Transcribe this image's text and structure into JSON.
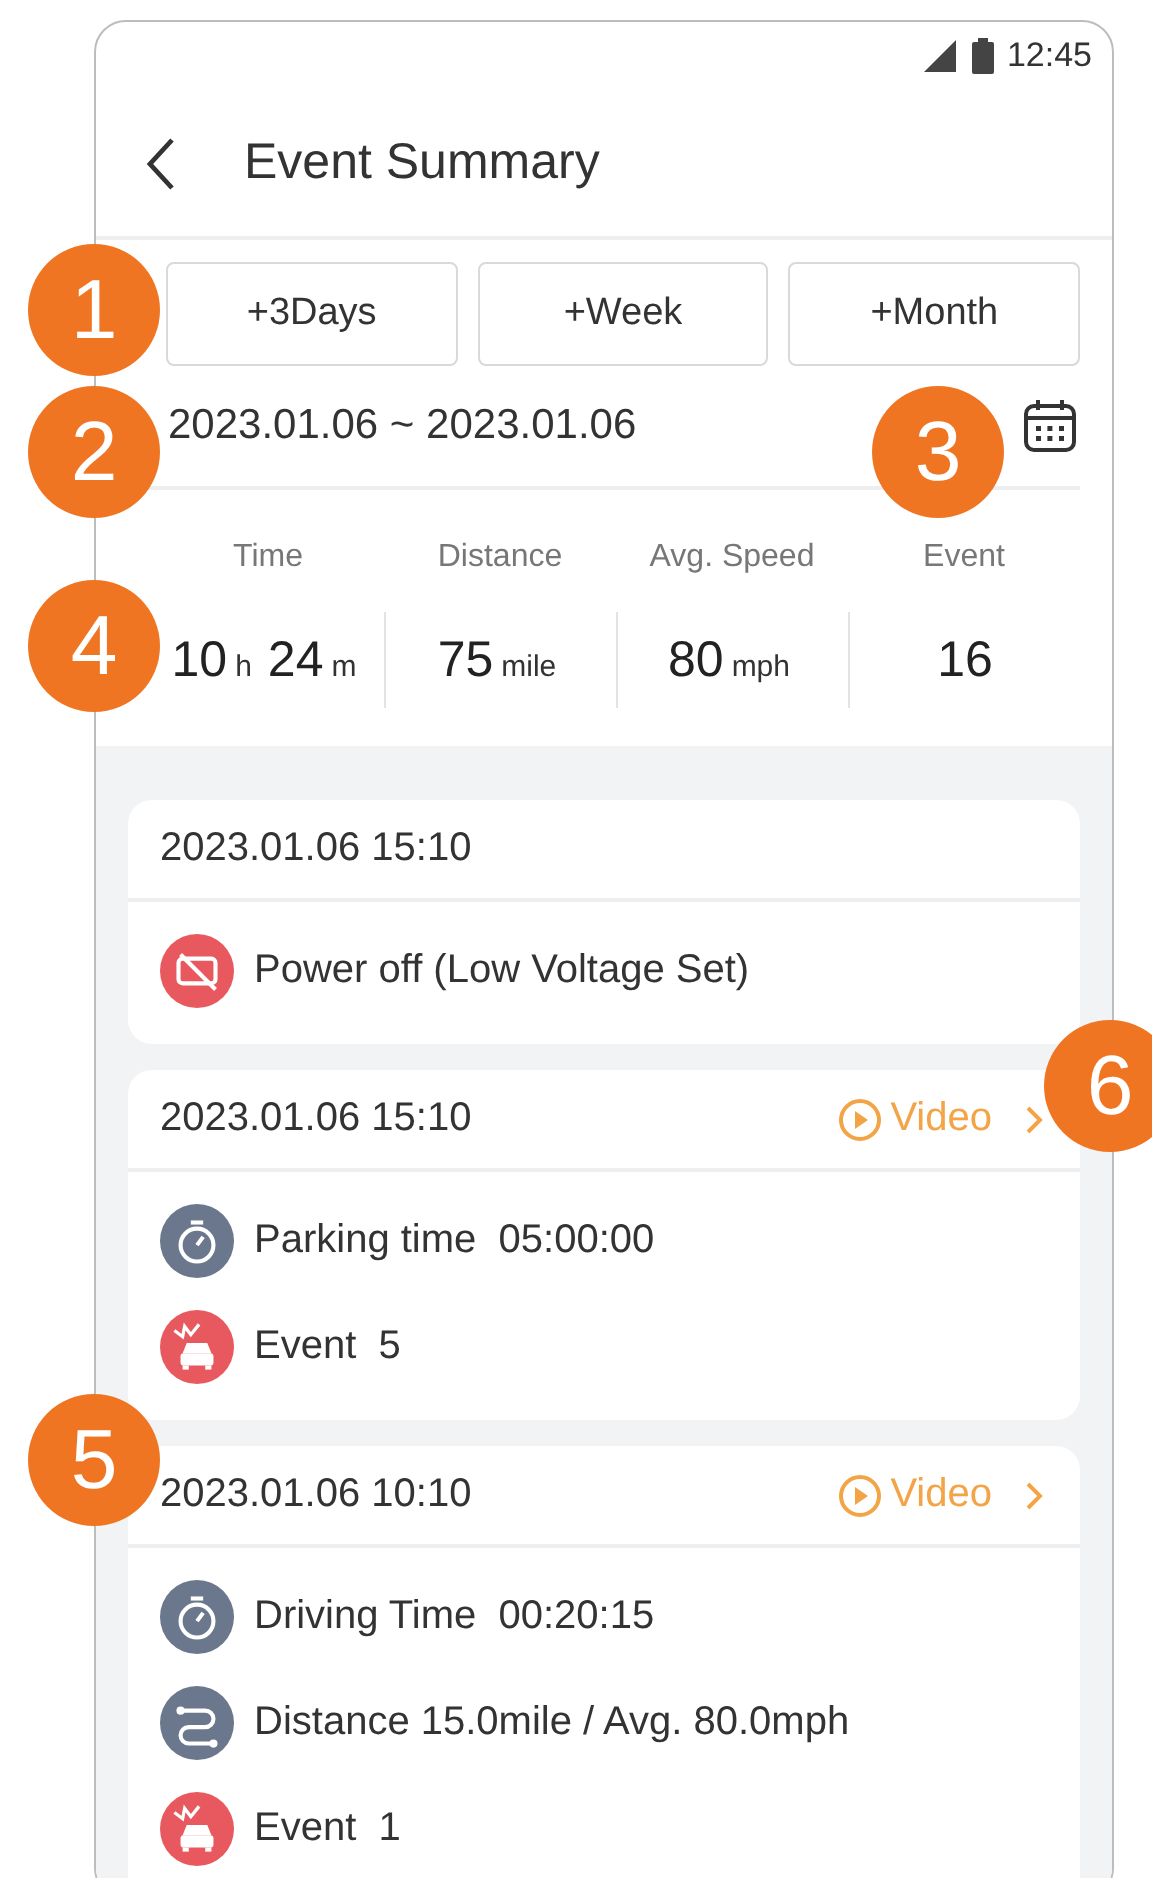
{
  "status_bar": {
    "time": "12:45"
  },
  "header": {
    "title": "Event Summary"
  },
  "range_buttons": [
    "+3Days",
    "+Week",
    "+Month"
  ],
  "date_range": "2023.01.06 ~ 2023.01.06",
  "stats": [
    {
      "label": "Time",
      "parts": [
        {
          "value": "10",
          "unit": "h"
        },
        {
          "value": "24",
          "unit": "m"
        }
      ]
    },
    {
      "label": "Distance",
      "parts": [
        {
          "value": "75",
          "unit": "mile"
        }
      ]
    },
    {
      "label": "Avg. Speed",
      "parts": [
        {
          "value": "80",
          "unit": "mph"
        }
      ]
    },
    {
      "label": "Event",
      "parts": [
        {
          "value": "16"
        }
      ]
    }
  ],
  "cards": [
    {
      "datetime": "2023.01.06 15:10",
      "items": [
        {
          "kind": "power-off",
          "text": "Power off (Low Voltage Set)"
        }
      ]
    },
    {
      "datetime": "2023.01.06 15:10",
      "video": "Video",
      "items": [
        {
          "kind": "parking",
          "text": "Parking time  05:00:00"
        },
        {
          "kind": "event",
          "text": "Event  5"
        }
      ]
    },
    {
      "datetime": "2023.01.06 10:10",
      "video": "Video",
      "items": [
        {
          "kind": "driving",
          "text": "Driving Time  00:20:15"
        },
        {
          "kind": "distance",
          "text": "Distance 15.0mile / Avg. 80.0mph"
        },
        {
          "kind": "event",
          "text": "Event  1"
        }
      ]
    }
  ],
  "callouts": [
    "1",
    "2",
    "3",
    "4",
    "5",
    "6"
  ]
}
